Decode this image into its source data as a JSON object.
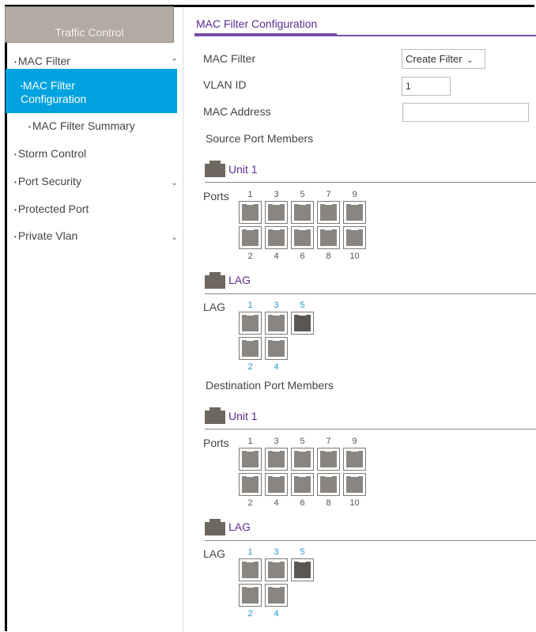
{
  "sidebar": {
    "header": "Traffic Control",
    "items": [
      {
        "label": "MAC Filter",
        "chevron": "^"
      },
      {
        "label": "MAC Filter Configuration",
        "line1": "MAC Filter",
        "line2": "Configuration"
      },
      {
        "label": "MAC Filter Summary"
      },
      {
        "label": "Storm Control"
      },
      {
        "label": "Port Security",
        "chevron": "v"
      },
      {
        "label": "Protected Port"
      },
      {
        "label": "Private Vlan",
        "chevron": "v"
      }
    ]
  },
  "main": {
    "title": "MAC Filter Configuration",
    "mac_filter_label": "MAC Filter",
    "mac_filter_value": "Create Filter",
    "vlan_label": "VLAN ID",
    "vlan_value": "1",
    "mac_address_label": "MAC Address",
    "mac_address_value": "",
    "source_title": "Source Port Members",
    "dest_title": "Destination Port Members",
    "unit_label": "Unit 1",
    "lag_section_label": "LAG",
    "ports_label": "Ports",
    "lag_label": "LAG",
    "ports_top": [
      "1",
      "3",
      "5",
      "7",
      "9"
    ],
    "ports_bottom": [
      "2",
      "4",
      "6",
      "8",
      "10"
    ],
    "lag_top": [
      "1",
      "3",
      "5"
    ],
    "lag_bottom": [
      "2",
      "4"
    ]
  },
  "colors": {
    "accent": "#5d2a91",
    "active_nav": "#00a2e0",
    "header_bg": "#b3aaa2",
    "lag_number": "#2196d6"
  }
}
